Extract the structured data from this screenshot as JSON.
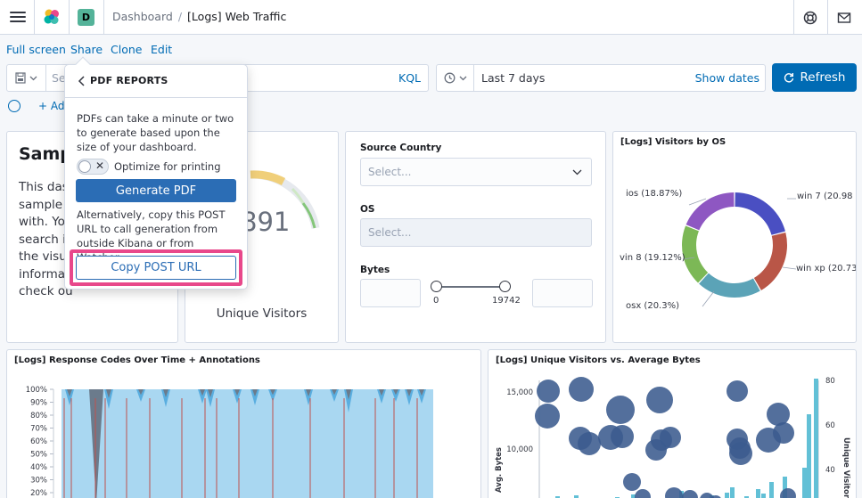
{
  "header": {
    "avatar_initial": "D",
    "breadcrumb_parent": "Dashboard",
    "breadcrumb_separator": "/",
    "breadcrumb_current": "[Logs] Web Traffic"
  },
  "menu": {
    "full_screen": "Full screen",
    "share": "Share",
    "clone": "Clone",
    "edit": "Edit"
  },
  "query": {
    "placeholder": "Sea",
    "language": "KQL"
  },
  "time": {
    "range": "Last 7 days",
    "show_dates": "Show dates",
    "refresh_label": "Refresh"
  },
  "filters": {
    "add_label": "+ Add"
  },
  "popover": {
    "title": "PDF REPORTS",
    "description": "PDFs can take a minute or two to generate based upon the size of your dashboard.",
    "optimize_label": "Optimize for printing",
    "optimize_on": false,
    "generate_label": "Generate PDF",
    "alternative_text": "Alternatively, copy this POST URL to call generation from outside Kibana or from Watcher.",
    "copy_label": "Copy POST URL"
  },
  "markdown_panel": {
    "heading": "Samp",
    "body_lines": [
      "This das",
      "sample d",
      "with. You",
      "search it",
      "the visua",
      "informat",
      "check ou"
    ]
  },
  "gauge_panel": {
    "value_fragment": "891",
    "label": "Unique Visitors"
  },
  "controls_panel": {
    "source_country_label": "Source Country",
    "source_country_placeholder": "Select...",
    "os_label": "OS",
    "os_placeholder": "Select...",
    "bytes_label": "Bytes",
    "bytes_min": "0",
    "bytes_max": "19742"
  },
  "visitors_by_os": {
    "title": "[Logs] Visitors by OS",
    "labels": {
      "ios": "ios (18.87%)",
      "win7": "win 7 (20.98",
      "win8": "vin 8 (19.12%)",
      "winxp": "win xp (20.73",
      "osx": "osx (20.3%)"
    },
    "colors": {
      "win7": "#6092c0",
      "winxp": "#d36086",
      "osx": "#9170b8",
      "win8": "#ca8eae",
      "ios": "#d6bf57"
    },
    "slices": [
      {
        "name": "win 7",
        "value": 20.98,
        "color": "#4a4fc2"
      },
      {
        "name": "win xp",
        "value": 20.73,
        "color": "#b95647"
      },
      {
        "name": "osx",
        "value": 20.3,
        "color": "#5ba3b7"
      },
      {
        "name": "win 8",
        "value": 19.12,
        "color": "#7cb856"
      },
      {
        "name": "ios",
        "value": 18.87,
        "color": "#8e57c2"
      }
    ]
  },
  "response_codes": {
    "title": "[Logs] Response Codes Over Time + Annotations",
    "y_ticks": [
      "100%",
      "90%",
      "80%",
      "70%",
      "60%",
      "50%",
      "40%",
      "30%",
      "20%"
    ]
  },
  "unique_vs_bytes": {
    "title": "[Logs] Unique Visitors vs. Average Bytes",
    "left_ticks": [
      "15,000",
      "10,000"
    ],
    "right_ticks": [
      "80",
      "60",
      "40"
    ],
    "left_axis_label": "Avg. Bytes",
    "right_axis_label": "Unique Visitors"
  }
}
